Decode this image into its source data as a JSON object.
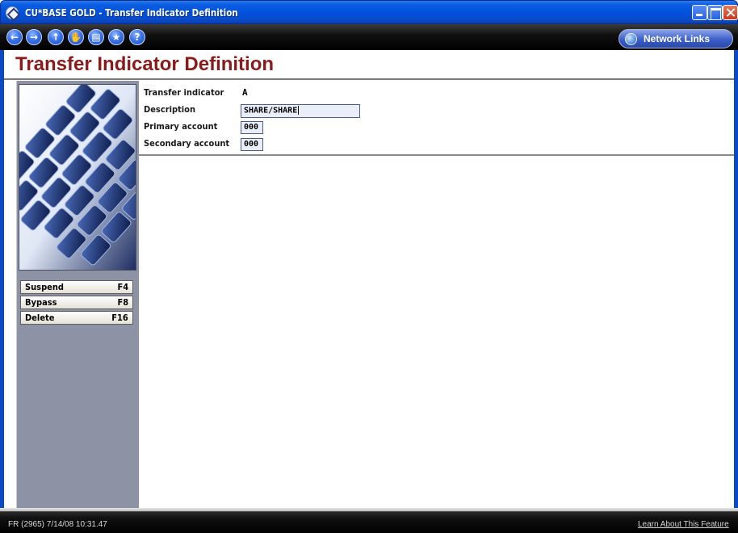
{
  "window": {
    "title": "CU*BASE GOLD - Transfer Indicator Definition"
  },
  "toolbar": {
    "nav_buttons": [
      {
        "icon": "back-arrow-icon",
        "glyph": "←"
      },
      {
        "icon": "forward-arrow-icon",
        "glyph": "→"
      },
      {
        "icon": "up-arrow-icon",
        "glyph": "↑"
      },
      {
        "icon": "hand-icon",
        "glyph": "✋"
      },
      {
        "icon": "print-icon",
        "glyph": "▤"
      },
      {
        "icon": "star-icon",
        "glyph": "★"
      },
      {
        "icon": "help-icon",
        "glyph": "?"
      }
    ],
    "network_links": "Network Links"
  },
  "page": {
    "title": "Transfer Indicator Definition"
  },
  "sidebar": {
    "buttons": [
      {
        "label": "Suspend",
        "key": "F4"
      },
      {
        "label": "Bypass",
        "key": "F8"
      },
      {
        "label": "Delete",
        "key": "F16"
      }
    ]
  },
  "form": {
    "transfer_indicator": {
      "label": "Transfer indicator",
      "value": "A"
    },
    "description": {
      "label": "Description",
      "value": "SHARE/SHARE"
    },
    "primary_account": {
      "label": "Primary account",
      "value": "000"
    },
    "secondary_account": {
      "label": "Secondary account",
      "value": "000"
    }
  },
  "status": {
    "left": "FR (2965) 7/14/08 10:31.47",
    "link": "Learn About This Feature"
  },
  "colors": {
    "title_red": "#8b1a1a",
    "titlebar_blue": "#0050dc",
    "panel_gray": "#8d93a5"
  }
}
